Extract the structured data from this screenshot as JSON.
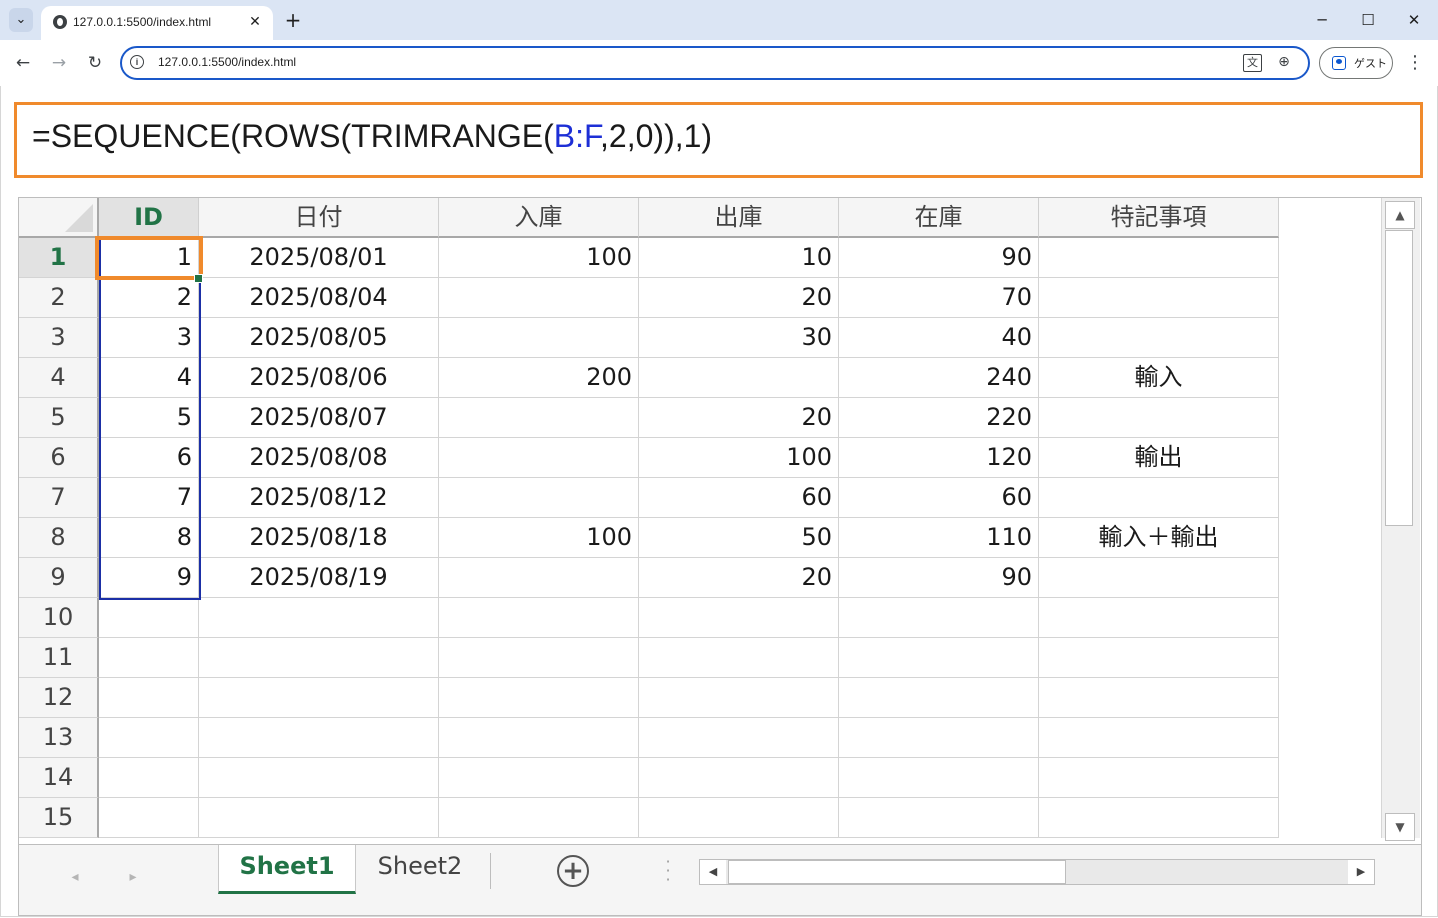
{
  "browser": {
    "tab_title": "127.0.0.1:5500/index.html",
    "url": "127.0.0.1:5500/index.html",
    "profile_label": "ゲスト",
    "icons": [
      "tab-search-icon",
      "favicon-icon",
      "close-icon",
      "new-tab-icon",
      "minimize-icon",
      "maximize-icon",
      "window-close-icon",
      "back-icon",
      "forward-icon",
      "reload-icon",
      "site-info-icon",
      "translate-icon",
      "zoom-icon",
      "profile-icon",
      "kebab-menu-icon"
    ]
  },
  "formula": {
    "prefix": "=SEQUENCE(ROWS(TRIMRANGE(",
    "range_ref": "B:F",
    "suffix": ",2,0)),1)",
    "ref_color": "#1d2fd6",
    "highlight_color": "#f08a2c"
  },
  "sheet": {
    "columns": [
      "ID",
      "日付",
      "入庫",
      "出庫",
      "在庫",
      "特記事項"
    ],
    "active_column": "ID",
    "active_row": "1",
    "row_numbers": [
      "1",
      "2",
      "3",
      "4",
      "5",
      "6",
      "7",
      "8",
      "9",
      "10",
      "11",
      "12",
      "13",
      "14",
      "15"
    ],
    "rows": [
      {
        "id": "1",
        "date": "2025/08/01",
        "in": "100",
        "out": "10",
        "stock": "90",
        "note": ""
      },
      {
        "id": "2",
        "date": "2025/08/04",
        "in": "",
        "out": "20",
        "stock": "70",
        "note": ""
      },
      {
        "id": "3",
        "date": "2025/08/05",
        "in": "",
        "out": "30",
        "stock": "40",
        "note": ""
      },
      {
        "id": "4",
        "date": "2025/08/06",
        "in": "200",
        "out": "",
        "stock": "240",
        "note": "輸入"
      },
      {
        "id": "5",
        "date": "2025/08/07",
        "in": "",
        "out": "20",
        "stock": "220",
        "note": ""
      },
      {
        "id": "6",
        "date": "2025/08/08",
        "in": "",
        "out": "100",
        "stock": "120",
        "note": "輸出"
      },
      {
        "id": "7",
        "date": "2025/08/12",
        "in": "",
        "out": "60",
        "stock": "60",
        "note": ""
      },
      {
        "id": "8",
        "date": "2025/08/18",
        "in": "100",
        "out": "50",
        "stock": "110",
        "note": "輸入＋輸出"
      },
      {
        "id": "9",
        "date": "2025/08/19",
        "in": "",
        "out": "20",
        "stock": "90",
        "note": ""
      }
    ],
    "tabs": [
      "Sheet1",
      "Sheet2"
    ],
    "active_tab": "Sheet1",
    "accent_color": "#217346",
    "spill_color": "#1b2fa6"
  }
}
